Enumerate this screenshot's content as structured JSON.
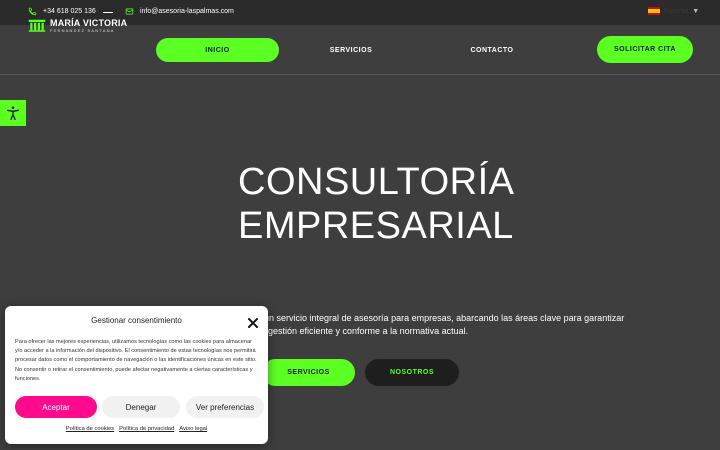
{
  "topbar": {
    "phone": "+34 618 025 136",
    "email": "info@asesoria-laspalmas.com",
    "language": "Español"
  },
  "logo": {
    "name": "MARÍA VICTORIA",
    "subtitle": "FERNANDEZ SANTANA"
  },
  "nav": {
    "items": [
      {
        "label": "INICIO",
        "active": true
      },
      {
        "label": "SERVICIOS",
        "active": false
      },
      {
        "label": "CONTACTO",
        "active": false
      }
    ],
    "cta": "SOLICITAR CITA"
  },
  "hero": {
    "title_line1": "CONSULTORÍA",
    "title_line2": "EMPRESARIAL",
    "text_line1": "un servicio integral de asesoría para empresas, abarcando las áreas clave para garantizar",
    "text_line2": "gestión eficiente y conforme a la normativa actual.",
    "btn_servicios": "SERVICIOS",
    "btn_nosotros": "NOSOTROS"
  },
  "consent": {
    "title": "Gestionar consentimiento",
    "text": "Para ofrecer las mejores experiencias, utilizamos tecnologías como las cookies para almacenar y/o acceder a la información del dispositivo. El consentimiento de estas tecnologías nos permitirá procesar datos como el comportamiento de navegación o las identificaciones únicas en este sitio. No consentir o retirar el consentimiento, puede afectar negativamente a ciertas características y funciones.",
    "accept": "Aceptar",
    "deny": "Denegar",
    "preferences": "Ver preferencias",
    "links": [
      "Política de cookies",
      "Política de privacidad",
      "Aviso legal"
    ]
  },
  "colors": {
    "accent": "#5cff22",
    "background": "#3e3e3e",
    "topbar": "#2b2b2b",
    "accept": "#ff0a8c"
  }
}
